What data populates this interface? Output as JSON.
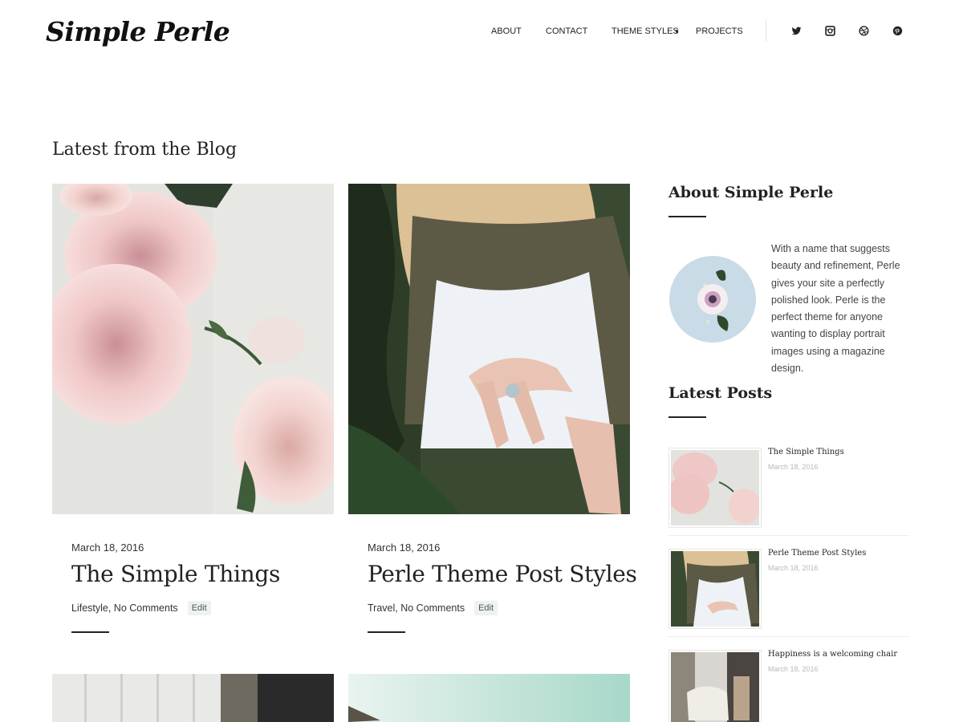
{
  "site": {
    "logo": "Simple Perle"
  },
  "nav": {
    "items": [
      {
        "label": "ABOUT"
      },
      {
        "label": "CONTACT"
      },
      {
        "label": "THEME STYLES"
      },
      {
        "label": "PROJECTS"
      }
    ],
    "social_icons": [
      "twitter-icon",
      "instagram-icon",
      "dribbble-icon",
      "pinterest-icon"
    ]
  },
  "main": {
    "section_title": "Latest from the Blog",
    "posts": [
      {
        "date": "March 18, 2016",
        "title": "The Simple Things",
        "meta": "Lifestyle, No Comments",
        "edit": "Edit"
      },
      {
        "date": "March 18, 2016",
        "title": "Perle Theme Post Styles",
        "meta": "Travel, No Comments",
        "edit": "Edit"
      }
    ]
  },
  "sidebar": {
    "about": {
      "title": "About Simple Perle",
      "text": "With a name that suggests beauty and refinement, Perle gives your site a perfectly polished look. Perle is the perfect theme for anyone wanting to display portrait images using a magazine design."
    },
    "latest": {
      "title": "Latest Posts",
      "items": [
        {
          "title": "The Simple Things",
          "date": "March 18, 2016"
        },
        {
          "title": "Perle Theme Post Styles",
          "date": "March 18, 2016"
        },
        {
          "title": "Happiness is a welcoming chair",
          "date": "March 18, 2016"
        }
      ]
    }
  },
  "colors": {
    "text": "#222222",
    "muted": "#b8b8b8",
    "edit_bg": "#eef2f3",
    "circle_bg": "#c9dbe6"
  }
}
